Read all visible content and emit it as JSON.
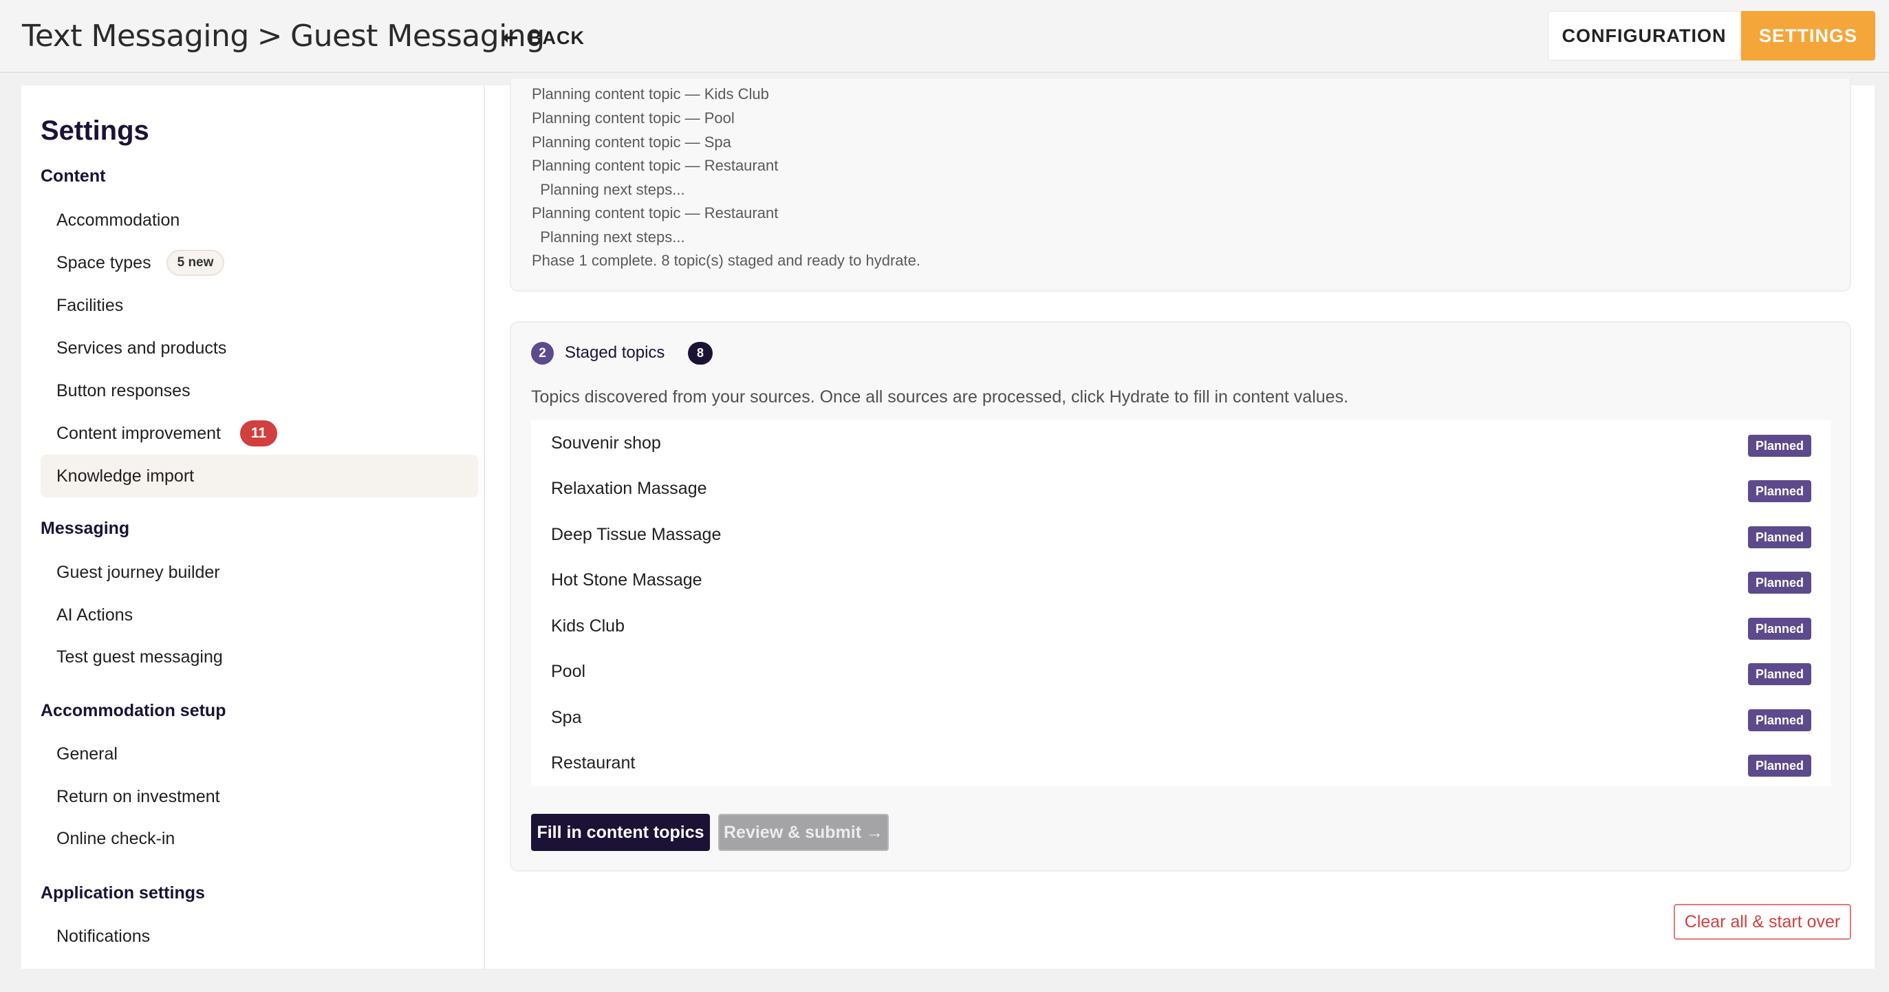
{
  "header": {
    "breadcrumb_parent": "Text Messaging",
    "breadcrumb_separator": ">",
    "breadcrumb_current": "Guest Messaging",
    "back_label": "BACK",
    "configuration_label": "CONFIGURATION",
    "settings_label": "SETTINGS",
    "accent_color": "#f4a63a"
  },
  "sidebar": {
    "title": "Settings",
    "sections": [
      {
        "label": "Content",
        "items": [
          {
            "label": "Accommodation"
          },
          {
            "label": "Space types",
            "badge": "5 new"
          },
          {
            "label": "Facilities"
          },
          {
            "label": "Services and products"
          },
          {
            "label": "Button responses"
          },
          {
            "label": "Content improvement",
            "count": "11"
          },
          {
            "label": "Knowledge import",
            "active": true
          }
        ]
      },
      {
        "label": "Messaging",
        "items": [
          {
            "label": "Guest journey builder"
          },
          {
            "label": "AI Actions"
          },
          {
            "label": "Test guest messaging"
          }
        ]
      },
      {
        "label": "Accommodation setup",
        "items": [
          {
            "label": "General"
          },
          {
            "label": "Return on investment"
          },
          {
            "label": "Online check-in"
          }
        ]
      },
      {
        "label": "Application settings",
        "items": [
          {
            "label": "Notifications"
          }
        ]
      }
    ]
  },
  "log": {
    "lines": [
      "Planning content topic — Kids Club",
      "Planning content topic — Pool",
      "Planning content topic — Spa",
      "Planning content topic — Restaurant",
      "  Planning next steps...",
      "Planning content topic — Restaurant",
      "  Planning next steps...",
      "Phase 1 complete. 8 topic(s) staged and ready to hydrate."
    ]
  },
  "staged": {
    "step_number": "2",
    "title": "Staged topics",
    "count": "8",
    "description": "Topics discovered from your sources. Once all sources are processed, click Hydrate to fill in content values.",
    "topics": [
      {
        "name": "Souvenir shop",
        "status": "Planned"
      },
      {
        "name": "Relaxation Massage",
        "status": "Planned"
      },
      {
        "name": "Deep Tissue Massage",
        "status": "Planned"
      },
      {
        "name": "Hot Stone Massage",
        "status": "Planned"
      },
      {
        "name": "Kids Club",
        "status": "Planned"
      },
      {
        "name": "Pool",
        "status": "Planned"
      },
      {
        "name": "Spa",
        "status": "Planned"
      },
      {
        "name": "Restaurant",
        "status": "Planned"
      }
    ],
    "fill_label": "Fill in content topics",
    "review_label": "Review & submit →"
  },
  "footer": {
    "clear_label": "Clear all & start over"
  }
}
